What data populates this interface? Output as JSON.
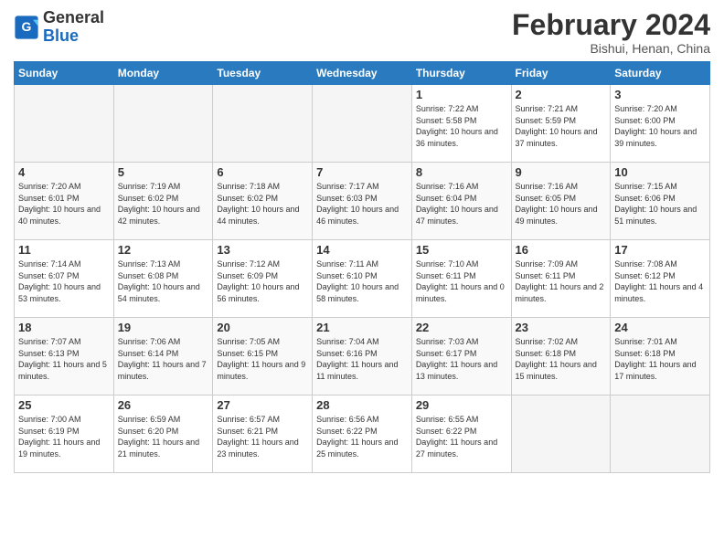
{
  "logo": {
    "line1": "General",
    "line2": "Blue"
  },
  "title": "February 2024",
  "location": "Bishui, Henan, China",
  "days_of_week": [
    "Sunday",
    "Monday",
    "Tuesday",
    "Wednesday",
    "Thursday",
    "Friday",
    "Saturday"
  ],
  "weeks": [
    [
      {
        "num": "",
        "empty": true
      },
      {
        "num": "",
        "empty": true
      },
      {
        "num": "",
        "empty": true
      },
      {
        "num": "",
        "empty": true
      },
      {
        "num": "1",
        "sunrise": "7:22 AM",
        "sunset": "5:58 PM",
        "daylight": "10 hours and 36 minutes."
      },
      {
        "num": "2",
        "sunrise": "7:21 AM",
        "sunset": "5:59 PM",
        "daylight": "10 hours and 37 minutes."
      },
      {
        "num": "3",
        "sunrise": "7:20 AM",
        "sunset": "6:00 PM",
        "daylight": "10 hours and 39 minutes."
      }
    ],
    [
      {
        "num": "4",
        "sunrise": "7:20 AM",
        "sunset": "6:01 PM",
        "daylight": "10 hours and 40 minutes."
      },
      {
        "num": "5",
        "sunrise": "7:19 AM",
        "sunset": "6:02 PM",
        "daylight": "10 hours and 42 minutes."
      },
      {
        "num": "6",
        "sunrise": "7:18 AM",
        "sunset": "6:02 PM",
        "daylight": "10 hours and 44 minutes."
      },
      {
        "num": "7",
        "sunrise": "7:17 AM",
        "sunset": "6:03 PM",
        "daylight": "10 hours and 46 minutes."
      },
      {
        "num": "8",
        "sunrise": "7:16 AM",
        "sunset": "6:04 PM",
        "daylight": "10 hours and 47 minutes."
      },
      {
        "num": "9",
        "sunrise": "7:16 AM",
        "sunset": "6:05 PM",
        "daylight": "10 hours and 49 minutes."
      },
      {
        "num": "10",
        "sunrise": "7:15 AM",
        "sunset": "6:06 PM",
        "daylight": "10 hours and 51 minutes."
      }
    ],
    [
      {
        "num": "11",
        "sunrise": "7:14 AM",
        "sunset": "6:07 PM",
        "daylight": "10 hours and 53 minutes."
      },
      {
        "num": "12",
        "sunrise": "7:13 AM",
        "sunset": "6:08 PM",
        "daylight": "10 hours and 54 minutes."
      },
      {
        "num": "13",
        "sunrise": "7:12 AM",
        "sunset": "6:09 PM",
        "daylight": "10 hours and 56 minutes."
      },
      {
        "num": "14",
        "sunrise": "7:11 AM",
        "sunset": "6:10 PM",
        "daylight": "10 hours and 58 minutes."
      },
      {
        "num": "15",
        "sunrise": "7:10 AM",
        "sunset": "6:11 PM",
        "daylight": "11 hours and 0 minutes."
      },
      {
        "num": "16",
        "sunrise": "7:09 AM",
        "sunset": "6:11 PM",
        "daylight": "11 hours and 2 minutes."
      },
      {
        "num": "17",
        "sunrise": "7:08 AM",
        "sunset": "6:12 PM",
        "daylight": "11 hours and 4 minutes."
      }
    ],
    [
      {
        "num": "18",
        "sunrise": "7:07 AM",
        "sunset": "6:13 PM",
        "daylight": "11 hours and 5 minutes."
      },
      {
        "num": "19",
        "sunrise": "7:06 AM",
        "sunset": "6:14 PM",
        "daylight": "11 hours and 7 minutes."
      },
      {
        "num": "20",
        "sunrise": "7:05 AM",
        "sunset": "6:15 PM",
        "daylight": "11 hours and 9 minutes."
      },
      {
        "num": "21",
        "sunrise": "7:04 AM",
        "sunset": "6:16 PM",
        "daylight": "11 hours and 11 minutes."
      },
      {
        "num": "22",
        "sunrise": "7:03 AM",
        "sunset": "6:17 PM",
        "daylight": "11 hours and 13 minutes."
      },
      {
        "num": "23",
        "sunrise": "7:02 AM",
        "sunset": "6:18 PM",
        "daylight": "11 hours and 15 minutes."
      },
      {
        "num": "24",
        "sunrise": "7:01 AM",
        "sunset": "6:18 PM",
        "daylight": "11 hours and 17 minutes."
      }
    ],
    [
      {
        "num": "25",
        "sunrise": "7:00 AM",
        "sunset": "6:19 PM",
        "daylight": "11 hours and 19 minutes."
      },
      {
        "num": "26",
        "sunrise": "6:59 AM",
        "sunset": "6:20 PM",
        "daylight": "11 hours and 21 minutes."
      },
      {
        "num": "27",
        "sunrise": "6:57 AM",
        "sunset": "6:21 PM",
        "daylight": "11 hours and 23 minutes."
      },
      {
        "num": "28",
        "sunrise": "6:56 AM",
        "sunset": "6:22 PM",
        "daylight": "11 hours and 25 minutes."
      },
      {
        "num": "29",
        "sunrise": "6:55 AM",
        "sunset": "6:22 PM",
        "daylight": "11 hours and 27 minutes."
      },
      {
        "num": "",
        "empty": true
      },
      {
        "num": "",
        "empty": true
      }
    ]
  ]
}
